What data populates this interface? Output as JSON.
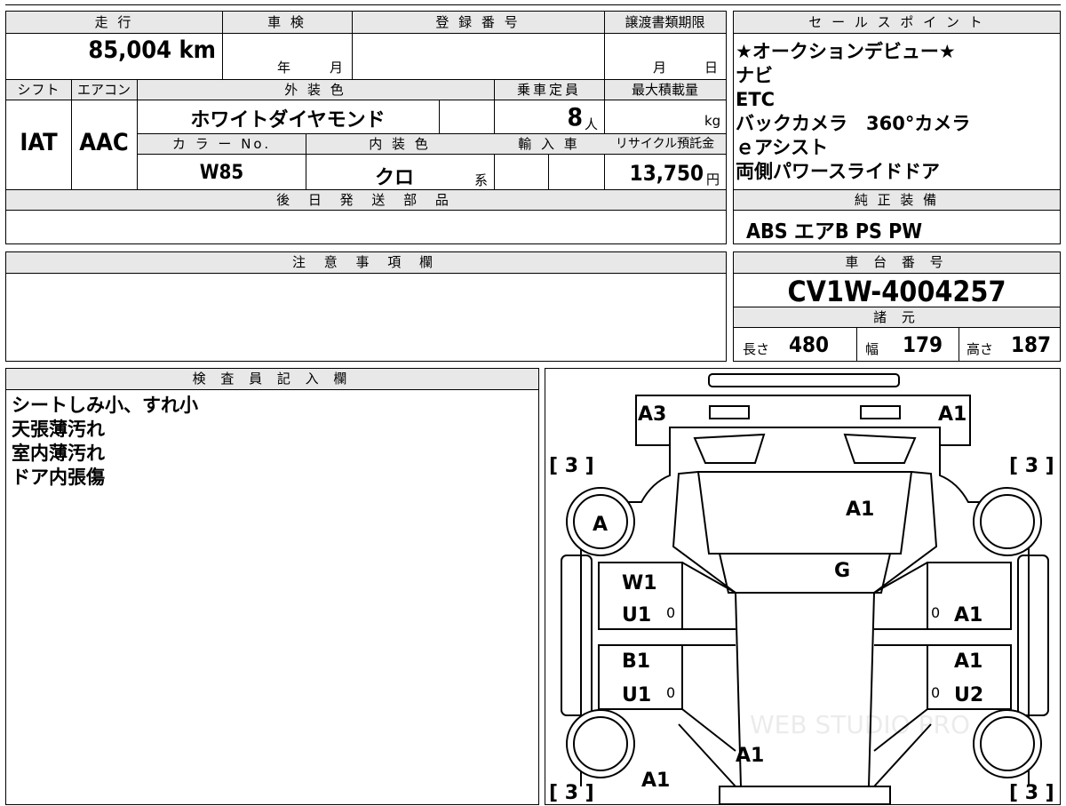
{
  "headers": {
    "mileage": "走 行",
    "inspection": "車 検",
    "registration_no": "登 録 番 号",
    "transfer_deadline": "譲渡書類期限",
    "sales_point": "セ ー ル ス ポ イ ン ト",
    "shift": "シフト",
    "aircon": "エアコン",
    "exterior_color": "外 装 色",
    "capacity": "乗車定員",
    "max_load": "最大積載量",
    "color_no": "カ ラ ー No.",
    "interior_color": "内 装 色",
    "import": "輸 入 車",
    "recycle": "リサイクル預託金",
    "later_parts": "後 日 発 送 部 品",
    "genuine_equipment": "純 正 装 備",
    "notes": "注 意 事 項 欄",
    "chassis_no": "車 台 番 号",
    "specs": "諸 元",
    "inspector": "検 査 員 記 入 欄"
  },
  "values": {
    "mileage": "85,004 km",
    "inspection_year_unit": "年",
    "inspection_month_unit": "月",
    "deadline_month_unit": "月",
    "deadline_day_unit": "日",
    "shift": "IAT",
    "aircon": "AAC",
    "exterior_color": "ホワイトダイヤモンド",
    "capacity": "8",
    "capacity_unit": "人",
    "max_load_unit": "kg",
    "color_no": "W85",
    "interior_color": "クロ",
    "interior_color_suffix": "系",
    "recycle_amount": "13,750",
    "recycle_unit": "円",
    "genuine_equipment": "ABS エアB PS PW",
    "chassis_no": "CV1W-4004257",
    "length_label": "長さ",
    "length": "480",
    "width_label": "幅",
    "width": "179",
    "height_label": "高さ",
    "height": "187"
  },
  "sales_points": [
    "★オークションデビュー★",
    "ナビ",
    "ETC",
    "バックカメラ　360°カメラ",
    "ｅアシスト",
    "両側パワースライドドア"
  ],
  "inspector_notes": [
    "シートしみ小、すれ小",
    "天張薄汚れ",
    "室内薄汚れ",
    "ドア内張傷"
  ],
  "diagram": {
    "front_left_corner": "A3",
    "front_right_corner": "A1",
    "hood": "A1",
    "windshield": "G",
    "front_left_wheel": "A",
    "tire_fl": "[ 3 ]",
    "tire_fr": "[ 3 ]",
    "tire_rl": "[ 3 ]",
    "tire_rr": "[ 3 ]",
    "left_front_door_1": "W1",
    "left_front_door_2": "U1",
    "left_rear_door_1": "B1",
    "left_rear_door_2": "U1",
    "right_front_door": "A1",
    "right_rear_door_1": "A1",
    "right_rear_door_2": "U2",
    "roof_rear": "A1",
    "rear": "A1",
    "zero_mark": "0",
    "watermark": "WEB STUDIO PRO"
  }
}
